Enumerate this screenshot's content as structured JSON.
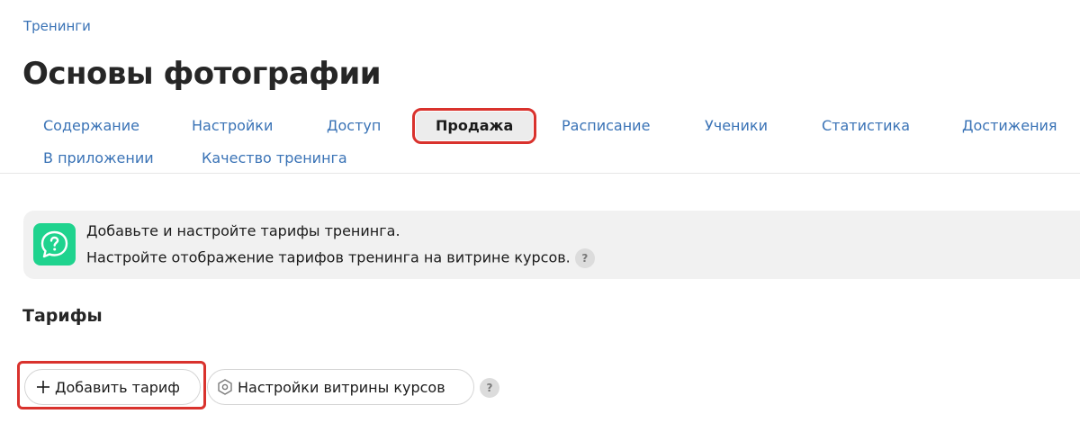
{
  "breadcrumb": {
    "label": "Тренинги"
  },
  "page": {
    "title": "Основы фотографии"
  },
  "tabs": [
    {
      "label": "Содержание",
      "active": false
    },
    {
      "label": "Настройки",
      "active": false
    },
    {
      "label": "Доступ",
      "active": false
    },
    {
      "label": "Продажа",
      "active": true
    },
    {
      "label": "Расписание",
      "active": false
    },
    {
      "label": "Ученики",
      "active": false
    },
    {
      "label": "Статистика",
      "active": false
    },
    {
      "label": "Достижения",
      "active": false
    },
    {
      "label": "В приложении",
      "active": false
    },
    {
      "label": "Качество тренинга",
      "active": false
    }
  ],
  "banner": {
    "icon": "question-chat-icon",
    "line1": "Добавьте и настройте тарифы тренинга.",
    "line2": "Настройте отображение тарифов тренинга на витрине курсов.",
    "help": "?"
  },
  "tariffs": {
    "title": "Тарифы",
    "add_button": "Добавить тариф",
    "add_icon": "plus-icon",
    "showcase_button": "Настройки витрины курсов",
    "showcase_icon": "hexagon-gear-icon",
    "help": "?"
  },
  "colors": {
    "link": "#3a73b6",
    "accent_green": "#1fd38e",
    "highlight_red": "#d9322d",
    "banner_bg": "#f1f1f1"
  }
}
